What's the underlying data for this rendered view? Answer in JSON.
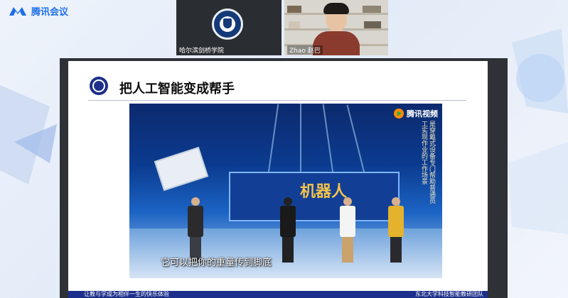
{
  "app": {
    "name": "腾讯会议",
    "logo_icon": "tencent-meeting-logo-icon",
    "brand_color": "#1e6fe8"
  },
  "participants": [
    {
      "name": "哈尔滨剑桥学院",
      "avatar_icon": "university-seal-icon"
    },
    {
      "name": "Zhao 赵巴"
    }
  ],
  "slide": {
    "title": "把人工智能变成帮手",
    "bullet_icon": "slide-bullet-icon",
    "accent_color": "#1c2f8a",
    "video": {
      "logo_text": "腾讯视频",
      "logo_icon": "play-icon",
      "screen_text": "机器人",
      "vertical_caption": "是穿戴式设备专门帮助普通员工实现作业的工作场景",
      "subtitle": "它可以把你的重量传到脚底"
    },
    "footer_left": "让教与学成为相伴一生的快乐体验",
    "footer_right": "东北大学科技智能教研团队"
  }
}
